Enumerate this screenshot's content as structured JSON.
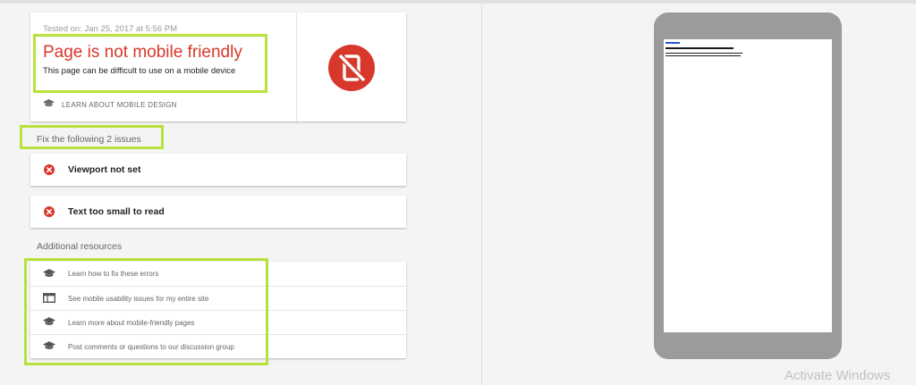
{
  "result": {
    "tested_on": "Tested on: Jan 25, 2017 at 5:56 PM",
    "headline": "Page is not mobile friendly",
    "subtext": "This page can be difficult to use on a mobile device",
    "learn_link": "LEARN ABOUT MOBILE DESIGN",
    "badge_color": "#d8382c"
  },
  "issues": {
    "heading": "Fix the following 2 issues",
    "items": [
      {
        "label": "Viewport not set",
        "icon": "error-circle-icon"
      },
      {
        "label": "Text too small to read",
        "icon": "error-circle-icon"
      }
    ]
  },
  "resources": {
    "heading": "Additional resources",
    "items": [
      {
        "label": "Learn how to fix these errors",
        "icon": "graduation-cap-icon"
      },
      {
        "label": "See mobile usability issues for my entire site",
        "icon": "browser-window-icon"
      },
      {
        "label": "Learn more about mobile-friendly pages",
        "icon": "graduation-cap-icon"
      },
      {
        "label": "Post comments or questions to our discussion group",
        "icon": "graduation-cap-icon"
      }
    ]
  },
  "colors": {
    "highlight": "#b6e23b",
    "error_red": "#d8382c"
  },
  "watermark": "Activate Windows"
}
